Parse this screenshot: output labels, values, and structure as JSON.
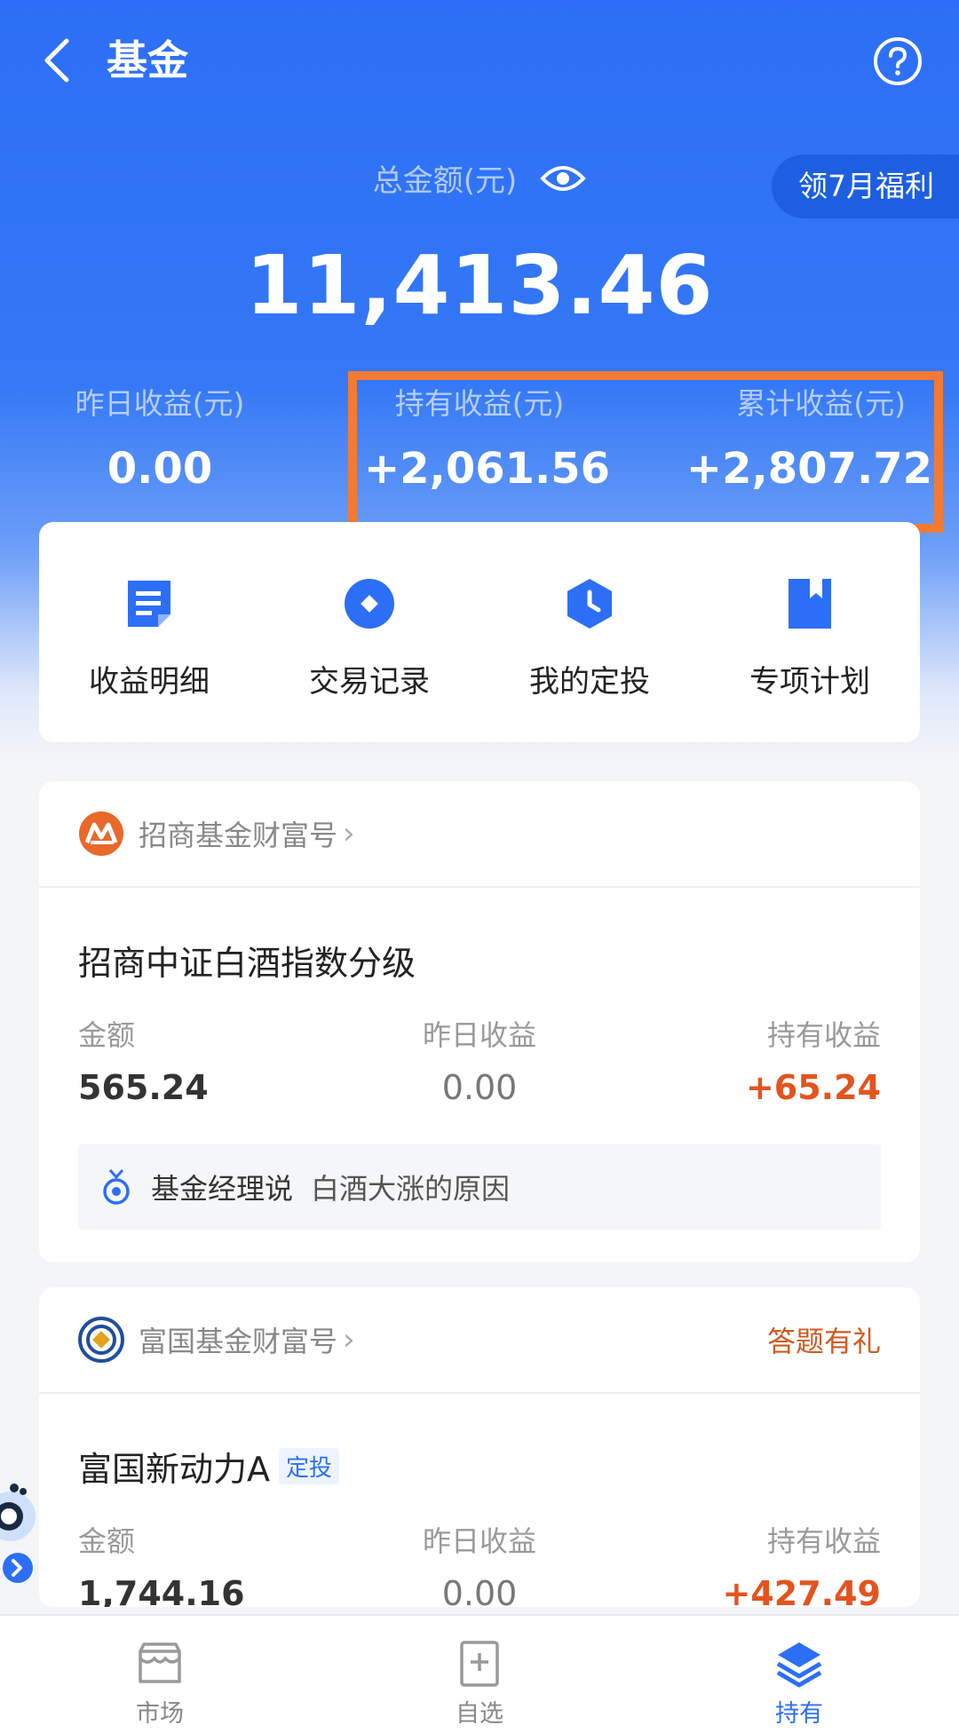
{
  "header": {
    "title": "基金"
  },
  "summary": {
    "total_label": "总金额(元)",
    "total_amount": "11,413.46",
    "promo_label": "领7月福利",
    "yesterday_label": "昨日收益(元)",
    "yesterday_value": "0.00",
    "holding_label": "持有收益(元)",
    "holding_value": "+2,061.56",
    "cumulative_label": "累计收益(元)",
    "cumulative_value": "+2,807.72"
  },
  "quick_actions": [
    {
      "label": "收益明细",
      "icon": "document-icon"
    },
    {
      "label": "交易记录",
      "icon": "diamond-record-icon"
    },
    {
      "label": "我的定投",
      "icon": "clock-hexagon-icon"
    },
    {
      "label": "专项计划",
      "icon": "bookmark-icon"
    }
  ],
  "funds": [
    {
      "brand": "招商基金财富号",
      "name": "招商中证白酒指数分级",
      "amount_label": "金额",
      "amount": "565.24",
      "yesterday_label": "昨日收益",
      "yesterday": "0.00",
      "holding_label": "持有收益",
      "holding": "+65.24",
      "insight_prefix": "基金经理说",
      "insight_text": "白酒大涨的原因"
    },
    {
      "brand": "富国基金财富号",
      "promo": "答题有礼",
      "name": "富国新动力A",
      "tag": "定投",
      "amount_label": "金额",
      "amount": "1,744.16",
      "yesterday_label": "昨日收益",
      "yesterday": "0.00",
      "holding_label": "持有收益",
      "holding": "+427.49"
    }
  ],
  "bottom_nav": [
    {
      "label": "市场",
      "icon": "market-icon"
    },
    {
      "label": "自选",
      "icon": "watchlist-icon"
    },
    {
      "label": "持有",
      "icon": "holdings-layers-icon",
      "active": true
    }
  ],
  "colors": {
    "primary": "#2c6ff6",
    "highlight": "#f47a31",
    "gain": "#e3541f"
  }
}
